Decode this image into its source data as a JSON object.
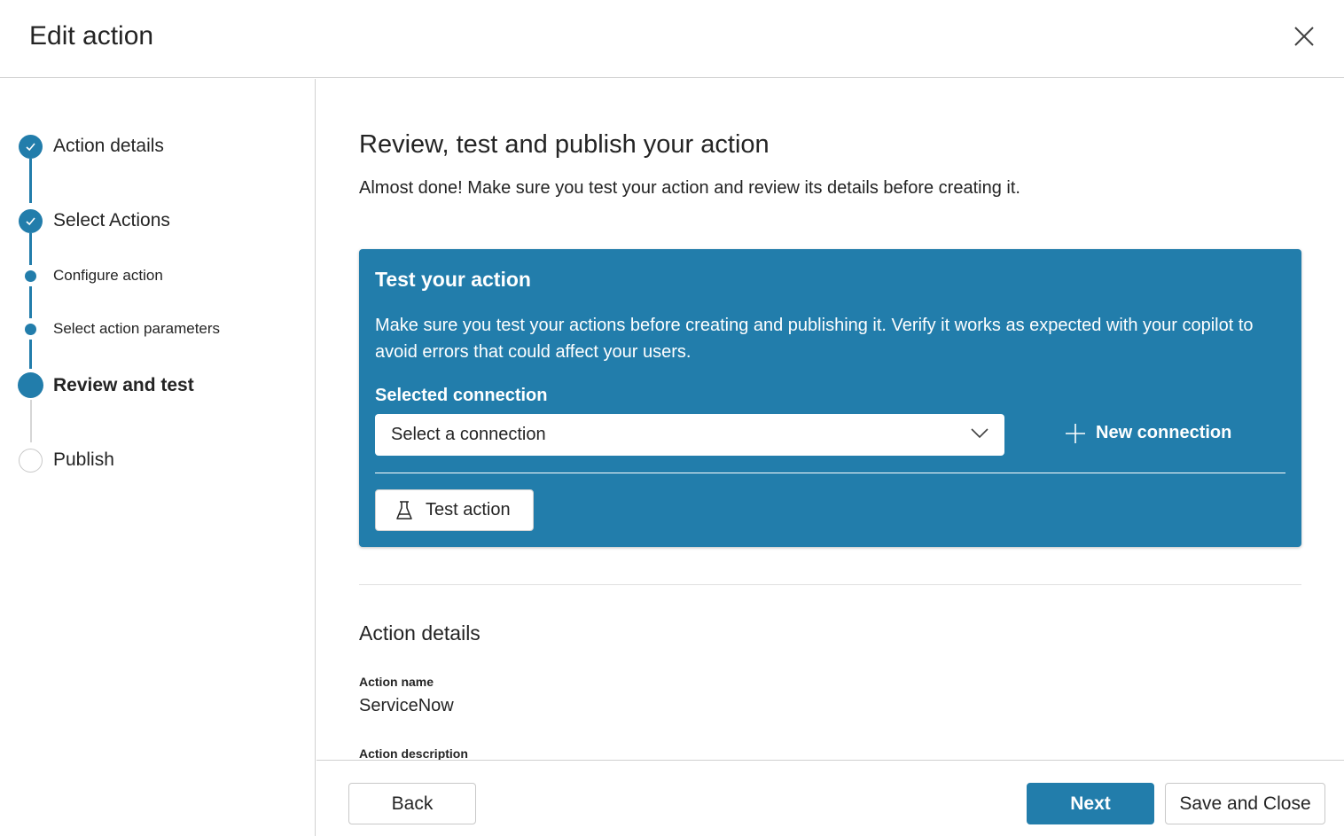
{
  "dialog": {
    "title": "Edit action",
    "close_icon": "close-icon"
  },
  "steps": [
    {
      "label": "Action details",
      "state": "completed"
    },
    {
      "label": "Select Actions",
      "state": "completed"
    },
    {
      "label": "Configure action",
      "state": "sub-completed"
    },
    {
      "label": "Select action parameters",
      "state": "sub-completed"
    },
    {
      "label": "Review and test",
      "state": "current"
    },
    {
      "label": "Publish",
      "state": "upcoming"
    }
  ],
  "main": {
    "heading": "Review, test and publish your action",
    "subheading": "Almost done! Make sure you test your action and review its details before creating it."
  },
  "test_card": {
    "title": "Test your action",
    "description": "Make sure you test your actions before creating and publishing it. Verify it works as expected with your copilot to avoid errors that could affect your users.",
    "connection_label": "Selected connection",
    "connection_placeholder": "Select a connection",
    "new_connection_label": "New connection",
    "test_button_label": "Test action",
    "background_color": "#227dab"
  },
  "details": {
    "heading": "Action details",
    "name_label": "Action name",
    "name_value": "ServiceNow",
    "description_label": "Action description"
  },
  "footer": {
    "back_label": "Back",
    "next_label": "Next",
    "save_close_label": "Save and Close"
  },
  "colors": {
    "accent": "#227dab",
    "text": "#242424",
    "border": "#d1d1d1"
  }
}
